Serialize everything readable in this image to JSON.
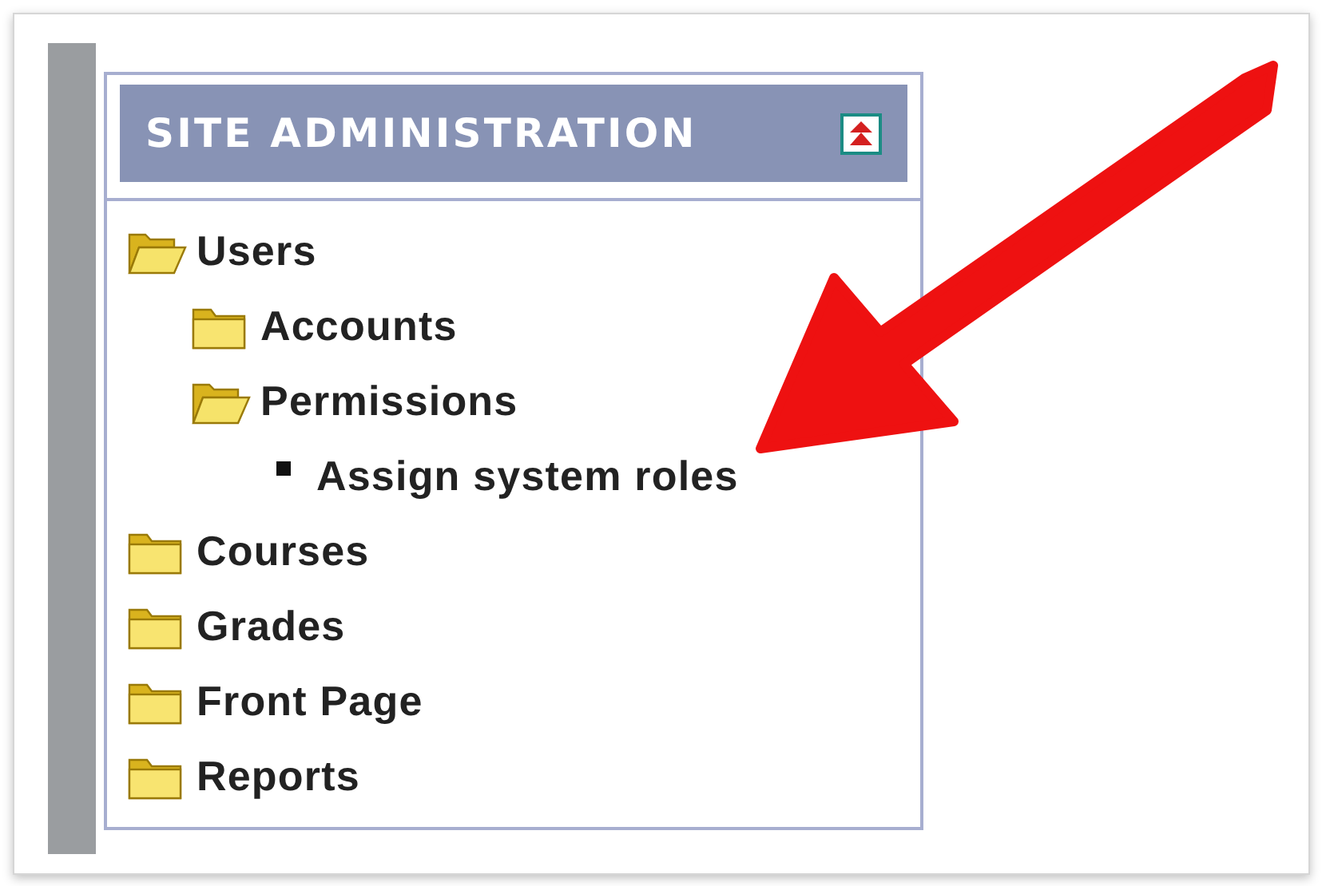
{
  "panel": {
    "title": "SITE ADMINISTRATION"
  },
  "tree": [
    {
      "label": "Users",
      "kind": "folder",
      "expanded": true,
      "children": [
        {
          "label": "Accounts",
          "kind": "folder",
          "expanded": false
        },
        {
          "label": "Permissions",
          "kind": "folder",
          "expanded": true,
          "children": [
            {
              "label": "Assign system roles",
              "kind": "leaf"
            }
          ]
        }
      ]
    },
    {
      "label": "Courses",
      "kind": "folder",
      "expanded": false
    },
    {
      "label": "Grades",
      "kind": "folder",
      "expanded": false
    },
    {
      "label": "Front Page",
      "kind": "folder",
      "expanded": false
    },
    {
      "label": "Reports",
      "kind": "folder",
      "expanded": false
    }
  ]
}
